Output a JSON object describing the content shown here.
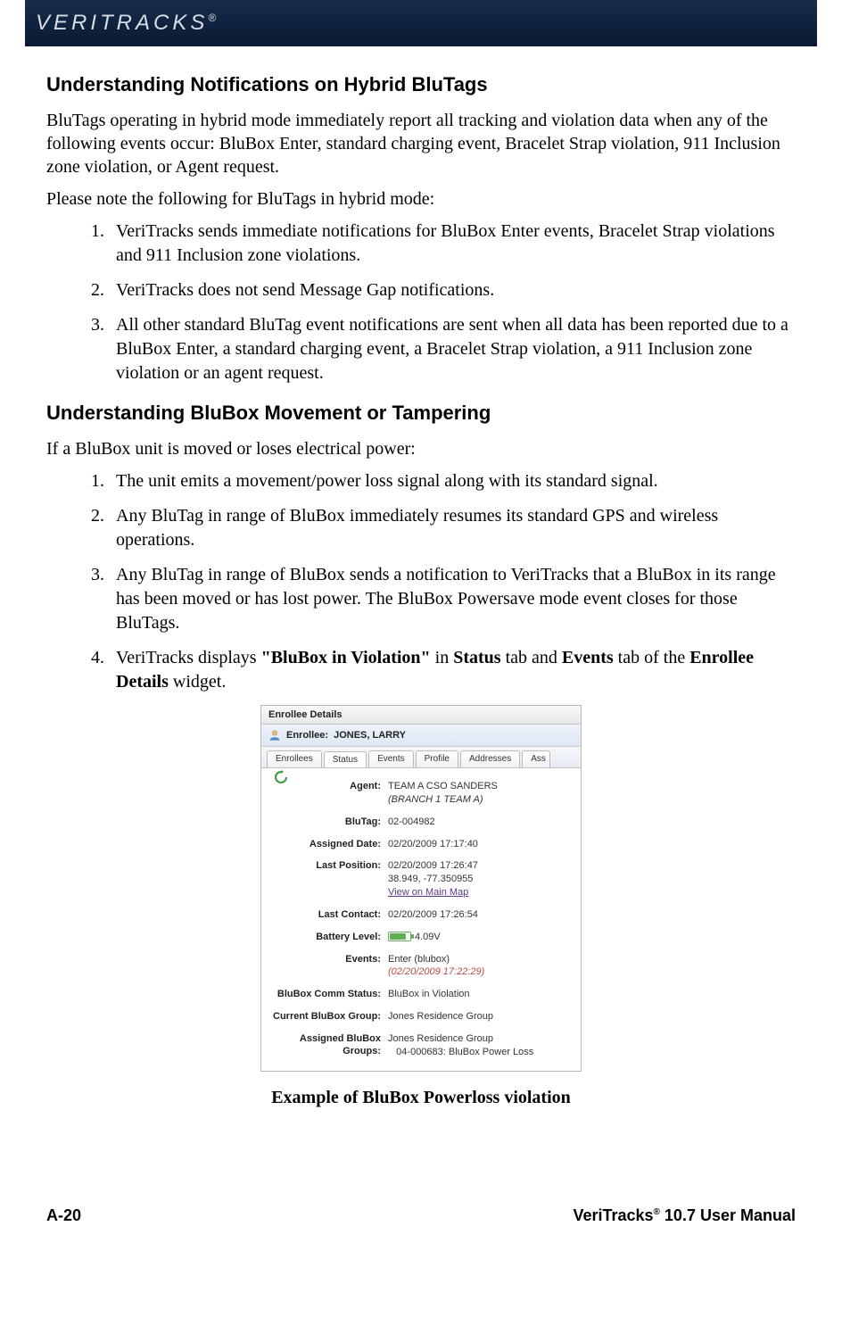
{
  "banner": {
    "logo_text": "VERITRACKS",
    "logo_reg": "®"
  },
  "section1": {
    "title": "Understanding Notifications on Hybrid BluTags",
    "para1": "BluTags operating in hybrid mode immediately report all tracking and violation data when any of the following events occur: BluBox Enter, standard charging event, Bracelet Strap violation, 911 Inclusion zone violation, or Agent request.",
    "para2": "Please note the following for BluTags in hybrid mode:",
    "items": [
      "VeriTracks sends immediate notifications for BluBox Enter events, Bracelet Strap violations and 911 Inclusion zone violations.",
      "VeriTracks does not send Message Gap notifications.",
      "All other standard BluTag event notifications are sent when all data has been reported due to a BluBox Enter, a standard charging event, a Bracelet Strap violation, a 911 Inclusion zone violation or an agent request."
    ]
  },
  "section2": {
    "title": "Understanding BluBox Movement or Tampering",
    "para1": "If a BluBox unit is moved or loses electrical power:",
    "items": {
      "0": "The unit emits a movement/power loss signal along with its standard signal.",
      "1": "Any BluTag in range of BluBox immediately resumes its standard GPS and wireless operations.",
      "2": "Any BluTag in range of BluBox sends a notification to VeriTracks that a BluBox in its range has been moved or has lost power.  The BluBox Powersave mode event closes for those BluTags.",
      "3_prefix": "VeriTracks displays ",
      "3_b1": "\"BluBox in Violation\"",
      "3_mid1": " in ",
      "3_b2": "Status",
      "3_mid2": " tab and ",
      "3_b3": "Events",
      "3_mid3": " tab of the ",
      "3_b4": "Enrollee Details",
      "3_suffix": " widget."
    }
  },
  "widget": {
    "title": "Enrollee Details",
    "enrollee_label": "Enrollee: ",
    "enrollee_name": "JONES, LARRY",
    "tabs": {
      "0": "Enrollees",
      "1": "Status",
      "2": "Events",
      "3": "Profile",
      "4": "Addresses",
      "5": "Ass"
    },
    "fields": {
      "agent": {
        "label": "Agent:",
        "value_line1": "TEAM A CSO SANDERS",
        "value_line2": "(BRANCH 1 TEAM A)"
      },
      "blutag": {
        "label": "BluTag:",
        "value": "02-004982"
      },
      "assigned_date": {
        "label": "Assigned Date:",
        "value": "02/20/2009 17:17:40"
      },
      "last_position": {
        "label": "Last Position:",
        "value_line1": "02/20/2009 17:26:47",
        "value_line2": "38.949, -77.350955",
        "link": "View on Main Map"
      },
      "last_contact": {
        "label": "Last Contact:",
        "value": "02/20/2009 17:26:54"
      },
      "battery": {
        "label": "Battery Level:",
        "value": "4.09V"
      },
      "events": {
        "label": "Events:",
        "value_line1": "Enter (blubox)",
        "value_line2": "(02/20/2009 17:22:29)"
      },
      "blubox_comm": {
        "label": "BluBox Comm Status:",
        "value": "BluBox in Violation"
      },
      "current_group": {
        "label": "Current BluBox Group:",
        "value": "Jones Residence Group"
      },
      "assigned_groups": {
        "label": "Assigned BluBox Groups:",
        "value_line1": "Jones Residence Group",
        "value_line2": "04-000683: BluBox Power Loss"
      }
    }
  },
  "caption": "Example of BluBox Powerloss violation",
  "footer": {
    "left": "A-20",
    "right_prefix": "VeriTracks",
    "right_reg": "®",
    "right_suffix": " 10.7 User Manual"
  }
}
